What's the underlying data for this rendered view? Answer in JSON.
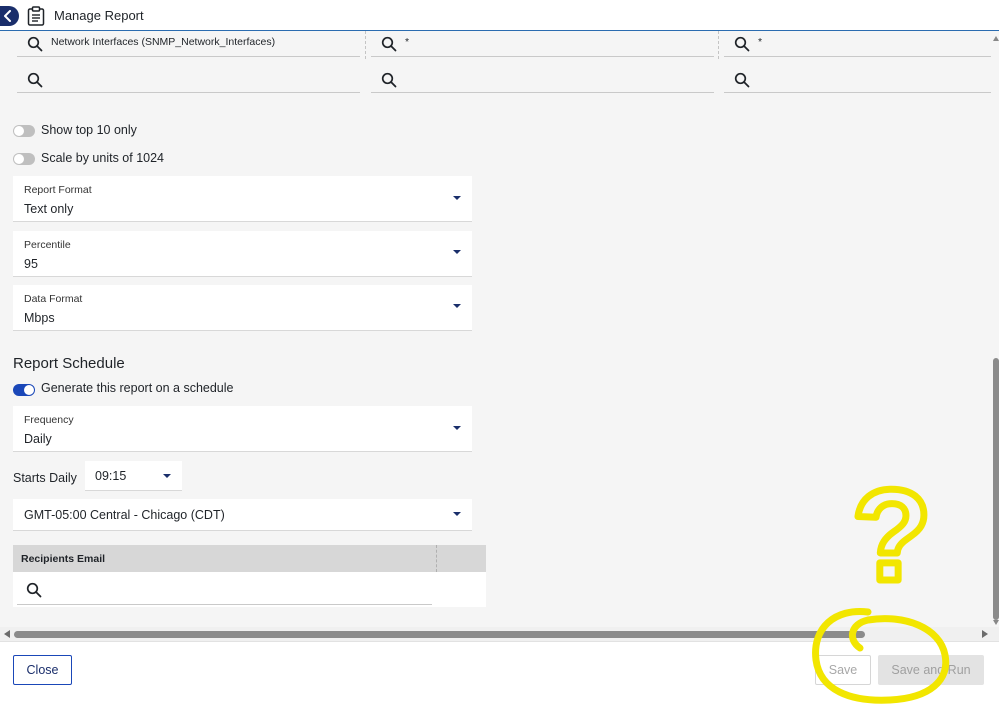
{
  "header": {
    "title": "Manage Report"
  },
  "search_rows": [
    [
      "Network Interfaces (SNMP_Network_Interfaces)",
      "*",
      "*"
    ],
    [
      "",
      "",
      ""
    ]
  ],
  "toggles": {
    "show_top10": {
      "label": "Show top 10 only",
      "on": false
    },
    "scale_1024": {
      "label": "Scale by units of 1024",
      "on": false
    }
  },
  "selects": {
    "report_format": {
      "label": "Report Format",
      "value": "Text only"
    },
    "percentile": {
      "label": "Percentile",
      "value": "95"
    },
    "data_format": {
      "label": "Data Format",
      "value": "Mbps"
    },
    "frequency": {
      "label": "Frequency",
      "value": "Daily"
    }
  },
  "schedule": {
    "section_title": "Report Schedule",
    "generate_toggle": {
      "label": "Generate this report on a schedule",
      "on": true
    },
    "starts_label": "Starts Daily",
    "start_time": "09:15",
    "timezone": "GMT-05:00 Central - Chicago (CDT)"
  },
  "recipients": {
    "header": "Recipients Email"
  },
  "footer": {
    "close_label": "Close",
    "save_label": "Save",
    "save_run_label": "Save and Run"
  },
  "annotation": {
    "question_mark": "?",
    "color": "#f2e600"
  },
  "colors": {
    "accent": "#1a47b8",
    "navy": "#1a2e6b",
    "panel_bg": "#f5f5f5"
  }
}
